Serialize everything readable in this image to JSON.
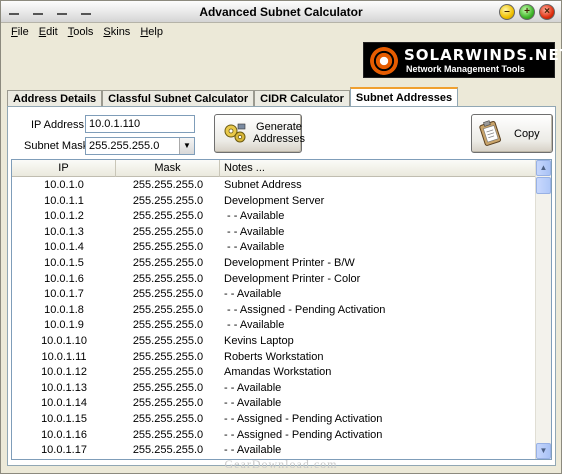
{
  "window": {
    "title": "Advanced Subnet Calculator"
  },
  "menu": [
    {
      "label": "File",
      "accel": "F",
      "rest": "ile"
    },
    {
      "label": "Edit",
      "accel": "E",
      "rest": "dit"
    },
    {
      "label": "Tools",
      "accel": "T",
      "rest": "ools"
    },
    {
      "label": "Skins",
      "accel": "S",
      "rest": "kins"
    },
    {
      "label": "Help",
      "accel": "H",
      "rest": "elp"
    }
  ],
  "banner": {
    "name": "SOLARWINDS.NET",
    "tagline": "Network Management Tools"
  },
  "tabs": [
    {
      "label": "Address Details",
      "active": false
    },
    {
      "label": "Classful Subnet Calculator",
      "active": false
    },
    {
      "label": "CIDR Calculator",
      "active": false
    },
    {
      "label": "Subnet Addresses",
      "active": true
    }
  ],
  "form": {
    "ip_label": "IP Address",
    "ip_value": "10.0.1.110",
    "mask_label": "Subnet Mask",
    "mask_value": "255.255.255.0",
    "generate_line1": "Generate",
    "generate_line2": "Addresses",
    "copy_label": "Copy"
  },
  "list": {
    "columns": [
      "IP",
      "Mask",
      "Notes ..."
    ],
    "rows": [
      {
        "ip": "10.0.1.0",
        "mask": "255.255.255.0",
        "notes": "Subnet Address"
      },
      {
        "ip": "10.0.1.1",
        "mask": "255.255.255.0",
        "notes": "Development Server"
      },
      {
        "ip": "10.0.1.2",
        "mask": "255.255.255.0",
        "notes": " - - Available"
      },
      {
        "ip": "10.0.1.3",
        "mask": "255.255.255.0",
        "notes": " - - Available"
      },
      {
        "ip": "10.0.1.4",
        "mask": "255.255.255.0",
        "notes": " - - Available"
      },
      {
        "ip": "10.0.1.5",
        "mask": "255.255.255.0",
        "notes": "Development Printer - B/W"
      },
      {
        "ip": "10.0.1.6",
        "mask": "255.255.255.0",
        "notes": "Development Printer - Color"
      },
      {
        "ip": "10.0.1.7",
        "mask": "255.255.255.0",
        "notes": "- - Available"
      },
      {
        "ip": "10.0.1.8",
        "mask": "255.255.255.0",
        "notes": " - - Assigned - Pending Activation"
      },
      {
        "ip": "10.0.1.9",
        "mask": "255.255.255.0",
        "notes": " - - Available"
      },
      {
        "ip": "10.0.1.10",
        "mask": "255.255.255.0",
        "notes": "Kevins Laptop"
      },
      {
        "ip": "10.0.1.11",
        "mask": "255.255.255.0",
        "notes": "Roberts Workstation"
      },
      {
        "ip": "10.0.1.12",
        "mask": "255.255.255.0",
        "notes": "Amandas Workstation"
      },
      {
        "ip": "10.0.1.13",
        "mask": "255.255.255.0",
        "notes": "- - Available"
      },
      {
        "ip": "10.0.1.14",
        "mask": "255.255.255.0",
        "notes": "- - Available"
      },
      {
        "ip": "10.0.1.15",
        "mask": "255.255.255.0",
        "notes": "- - Assigned - Pending Activation"
      },
      {
        "ip": "10.0.1.16",
        "mask": "255.255.255.0",
        "notes": "- - Assigned - Pending Activation"
      },
      {
        "ip": "10.0.1.17",
        "mask": "255.255.255.0",
        "notes": "- - Available"
      }
    ]
  },
  "watermark": "GearDownload.com",
  "colors": {
    "active_tab_accent": "#f0a030",
    "logo_orange": "#e65c00"
  }
}
